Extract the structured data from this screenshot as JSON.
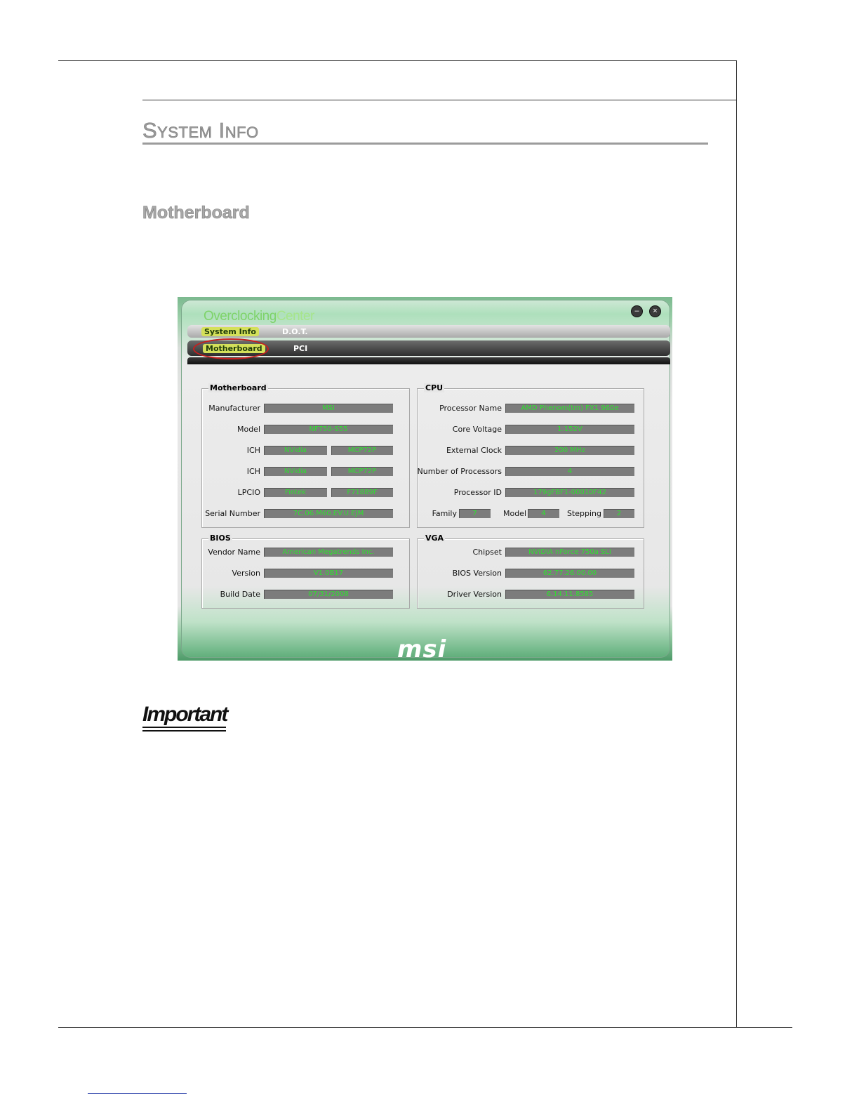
{
  "page": {
    "section_title": "System Info",
    "subsection_title": "Motherboard",
    "important_label": "Important"
  },
  "app": {
    "title_part1": "Overclocking",
    "title_part2": "Center",
    "minimize_symbol": "–",
    "close_symbol": "×",
    "tabs_row1": [
      "System Info",
      "D.O.T."
    ],
    "tabs_row2": [
      "Motherboard",
      "PCI"
    ],
    "logo": "msi",
    "motherboard": {
      "title": "Motherboard",
      "manufacturer_label": "Manufacturer",
      "manufacturer": "MSI",
      "model_label": "Model",
      "model": "NF750-S55",
      "ich1_label": "ICH",
      "ich1_vendor": "NVidia",
      "ich1_chip": "MCP72P",
      "ich2_label": "ICH",
      "ich2_vendor": "NVidia",
      "ich2_chip": "MCP72P",
      "lpcio_label": "LPCIO",
      "lpcio_vendor": "Fintek",
      "lpcio_chip": "F71889F",
      "serial_label": "Serial Number",
      "serial": "7C.06.M60.EV.U.EJM"
    },
    "cpu": {
      "title": "CPU",
      "name_label": "Processor Name",
      "name": "AMD Phenom(tm) FX1 960e",
      "voltage_label": "Core Voltage",
      "voltage": "1.152V",
      "clock_label": "External Clock",
      "clock": "200 MHz",
      "num_label": "Number of Processors",
      "num": "4",
      "id_label": "Processor ID",
      "id": "179gFBF1-00010F42",
      "family_label": "Family",
      "family": "7",
      "model_label": "Model",
      "model": "4",
      "stepping_label": "Stepping",
      "stepping": "2"
    },
    "bios": {
      "title": "BIOS",
      "vendor_label": "Vendor Name",
      "vendor": "American Megatrends Inc.",
      "version_label": "Version",
      "version": "V1.0B17",
      "date_label": "Build Date",
      "date": "07/31/2008"
    },
    "vga": {
      "title": "VGA",
      "chipset_label": "Chipset",
      "chipset": "NVIDIA nForce 750a SLI",
      "bios_label": "BIOS Version",
      "bios": "62.77.26.00.00",
      "driver_label": "Driver Version",
      "driver": "6.14.11.8585"
    }
  }
}
